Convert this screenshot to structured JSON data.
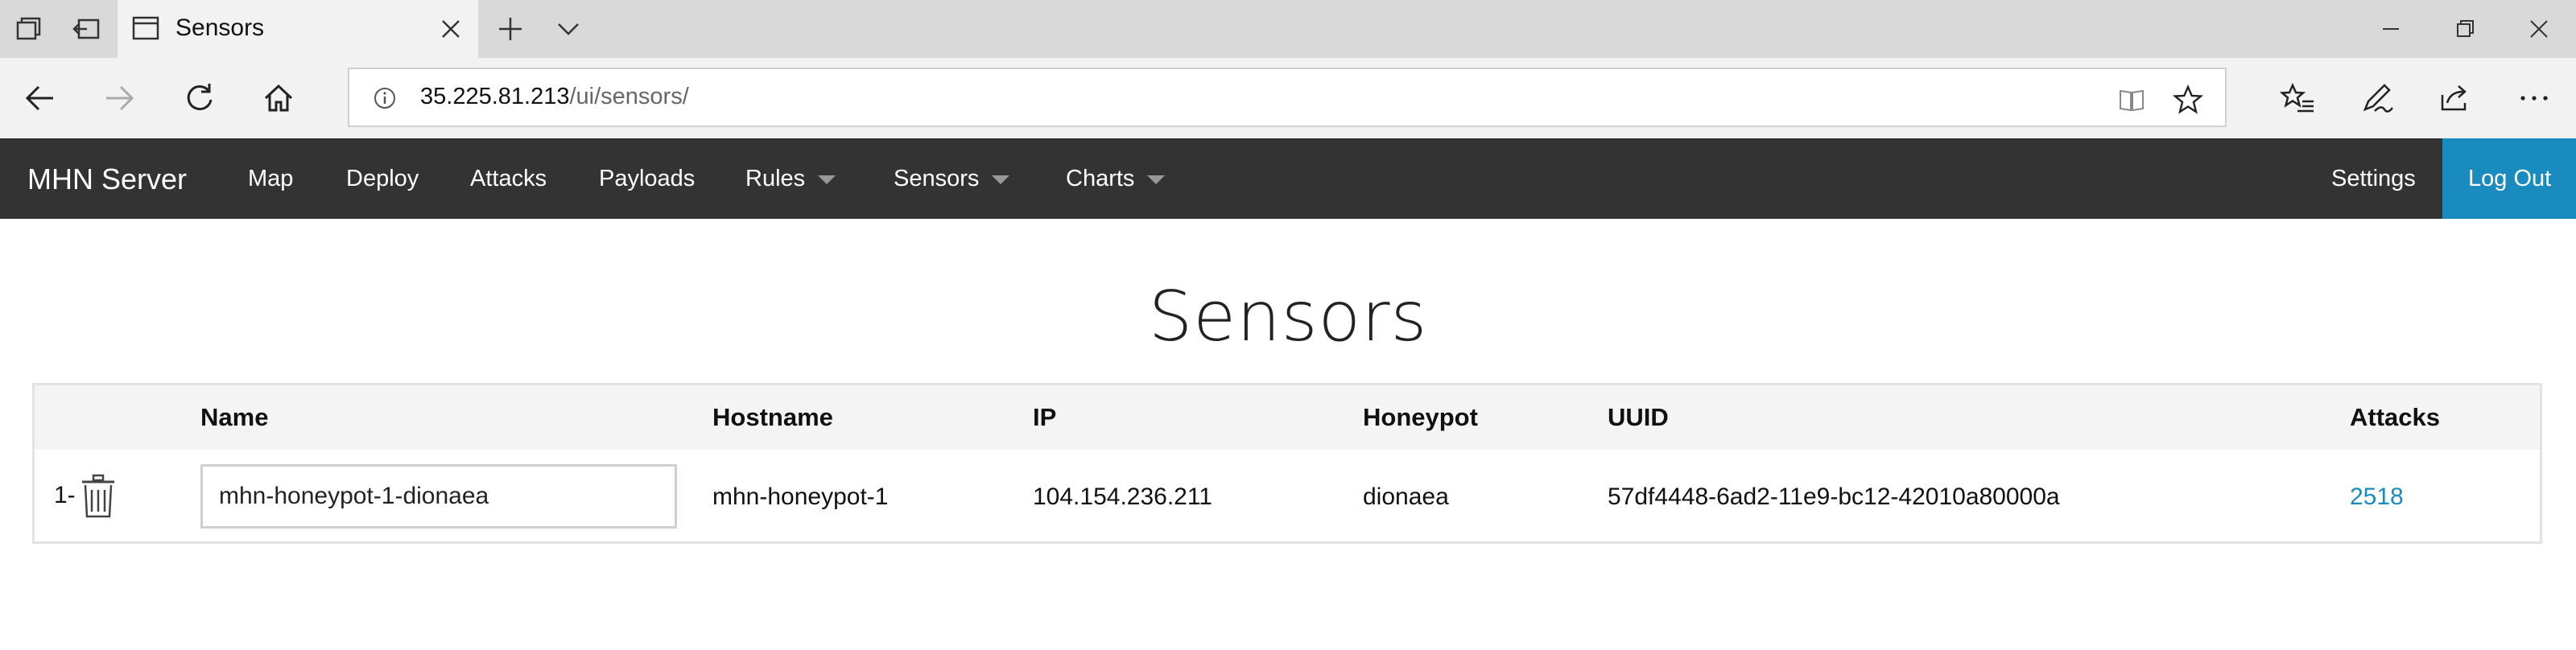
{
  "browser": {
    "tab_title": "Sensors",
    "url_host": "35.225.81.213",
    "url_path": "/ui/sensors/"
  },
  "navbar": {
    "brand": "MHN Server",
    "links": {
      "map": "Map",
      "deploy": "Deploy",
      "attacks": "Attacks",
      "payloads": "Payloads",
      "rules": "Rules",
      "sensors": "Sensors",
      "charts": "Charts"
    },
    "settings": "Settings",
    "logout": "Log Out",
    "colors": {
      "background": "#333333",
      "logout_bg": "#1a8bbf"
    }
  },
  "page": {
    "title": "Sensors"
  },
  "table": {
    "headers": {
      "name": "Name",
      "hostname": "Hostname",
      "ip": "IP",
      "honeypot": "Honeypot",
      "uuid": "UUID",
      "attacks": "Attacks"
    },
    "rows": [
      {
        "index": "1-",
        "name": "mhn-honeypot-1-dionaea",
        "hostname": "mhn-honeypot-1",
        "ip": "104.154.236.211",
        "honeypot": "dionaea",
        "uuid": "57df4448-6ad2-11e9-bc12-42010a80000a",
        "attacks": "2518"
      }
    ]
  },
  "icons": [
    "tab-actions-icon",
    "set-aside-tabs-icon",
    "page-icon",
    "close-tab-icon",
    "new-tab-icon",
    "tab-list-chevron-icon",
    "minimize-icon",
    "restore-icon",
    "close-window-icon",
    "back-arrow-icon",
    "forward-arrow-icon",
    "refresh-icon",
    "home-icon",
    "site-info-icon",
    "reading-view-icon",
    "favorite-star-icon",
    "favorites-icon",
    "pen-icon",
    "share-icon",
    "more-icon",
    "trash-icon"
  ]
}
